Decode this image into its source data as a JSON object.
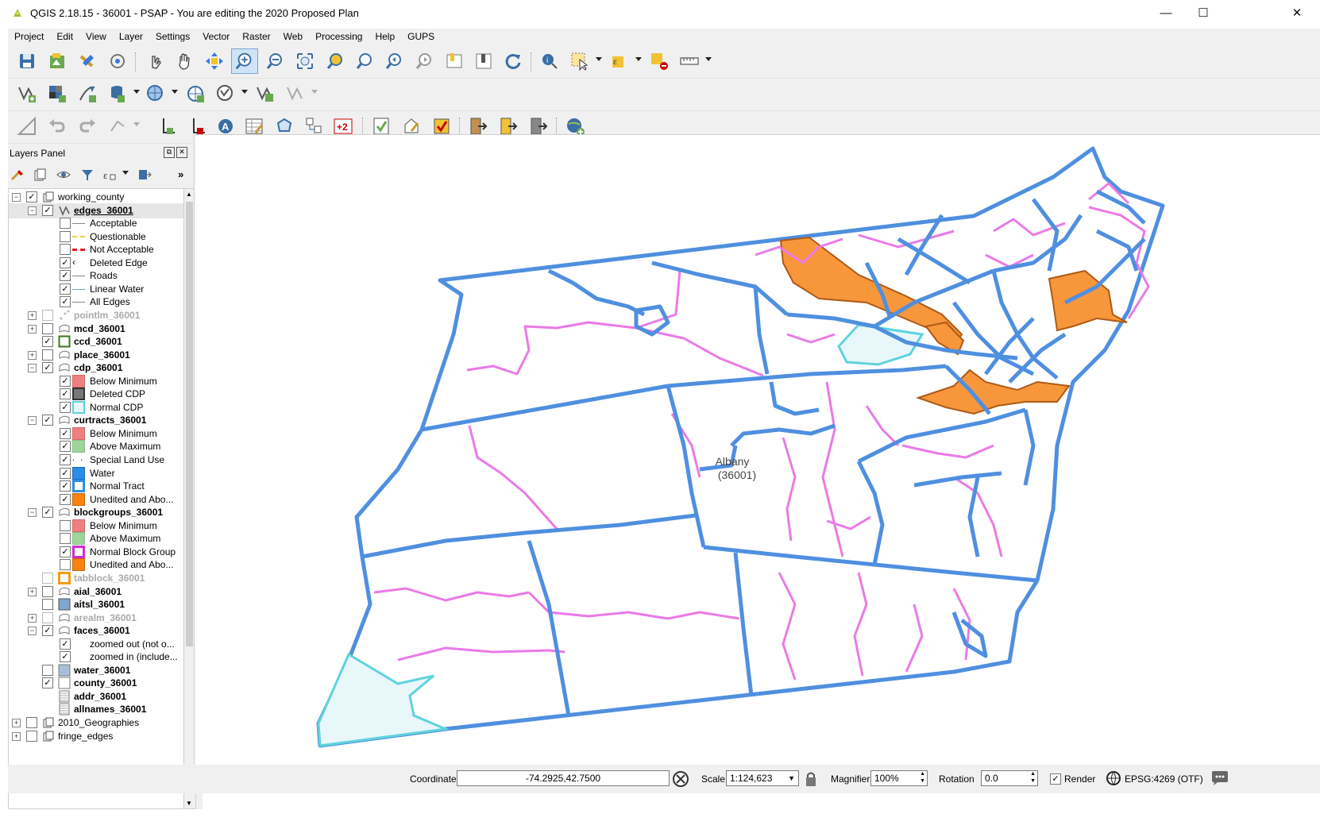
{
  "window": {
    "title": "QGIS 2.18.15 - 36001 - PSAP - You are editing the 2020 Proposed Plan",
    "minimize": "—",
    "maximize": "☐",
    "close": "✕"
  },
  "menu": [
    "Project",
    "Edit",
    "View",
    "Layer",
    "Settings",
    "Vector",
    "Raster",
    "Web",
    "Processing",
    "Help",
    "GUPS"
  ],
  "layers_panel": {
    "title": "Layers Panel",
    "more": "»",
    "tree": [
      {
        "label": "working_county",
        "depth": 0,
        "type": "group",
        "checked": true,
        "expand": "minus",
        "bold": false
      },
      {
        "label": "edges_36001",
        "depth": 1,
        "type": "line-layer",
        "checked": true,
        "expand": "minus",
        "bold": true,
        "selected": true
      },
      {
        "label": "Acceptable",
        "depth": 2,
        "type": "legend",
        "checked": false,
        "symbol": "line-gray"
      },
      {
        "label": "Questionable",
        "depth": 2,
        "type": "legend",
        "checked": false,
        "symbol": "line-yellow-dash"
      },
      {
        "label": "Not Acceptable",
        "depth": 2,
        "type": "legend",
        "checked": false,
        "symbol": "line-red-dash"
      },
      {
        "label": "Deleted Edge",
        "depth": 2,
        "type": "legend",
        "checked": true,
        "symbol": "chevron"
      },
      {
        "label": "Roads",
        "depth": 2,
        "type": "legend",
        "checked": true,
        "symbol": "line-gray"
      },
      {
        "label": "Linear Water",
        "depth": 2,
        "type": "legend",
        "checked": true,
        "symbol": "line-lightblue"
      },
      {
        "label": "All Edges",
        "depth": 2,
        "type": "legend",
        "checked": true,
        "symbol": "line-gray"
      },
      {
        "label": "pointlm_36001",
        "depth": 1,
        "type": "point-layer",
        "checked": false,
        "expand": "plus",
        "bold": true,
        "dim": true
      },
      {
        "label": "mcd_36001",
        "depth": 1,
        "type": "polygon-layer",
        "checked": false,
        "expand": "plus",
        "bold": true
      },
      {
        "label": "ccd_36001",
        "depth": 1,
        "type": "box-green",
        "checked": true,
        "bold": true
      },
      {
        "label": "place_36001",
        "depth": 1,
        "type": "polygon-layer",
        "checked": false,
        "expand": "plus",
        "bold": true
      },
      {
        "label": "cdp_36001",
        "depth": 1,
        "type": "polygon-layer",
        "checked": true,
        "expand": "minus",
        "bold": true
      },
      {
        "label": "Below Minimum",
        "depth": 2,
        "type": "legend",
        "checked": true,
        "symbol": "fill-salmon"
      },
      {
        "label": "Deleted CDP",
        "depth": 2,
        "type": "legend",
        "checked": true,
        "symbol": "fill-darkgray"
      },
      {
        "label": "Normal CDP",
        "depth": 2,
        "type": "legend",
        "checked": true,
        "symbol": "fill-cyan-outline"
      },
      {
        "label": "curtracts_36001",
        "depth": 1,
        "type": "polygon-layer",
        "checked": true,
        "expand": "minus",
        "bold": true
      },
      {
        "label": "Below Minimum",
        "depth": 2,
        "type": "legend",
        "checked": true,
        "symbol": "fill-salmon"
      },
      {
        "label": "Above Maximum",
        "depth": 2,
        "type": "legend",
        "checked": true,
        "symbol": "fill-lightgreen"
      },
      {
        "label": "Special Land Use",
        "depth": 2,
        "type": "legend",
        "checked": true,
        "symbol": "dots"
      },
      {
        "label": "Water",
        "depth": 2,
        "type": "legend",
        "checked": true,
        "symbol": "fill-blue"
      },
      {
        "label": "Normal Tract",
        "depth": 2,
        "type": "legend",
        "checked": true,
        "symbol": "fill-blue-outline"
      },
      {
        "label": "Unedited and Abo...",
        "depth": 2,
        "type": "legend",
        "checked": true,
        "symbol": "fill-orange"
      },
      {
        "label": "blockgroups_36001",
        "depth": 1,
        "type": "polygon-layer",
        "checked": true,
        "expand": "minus",
        "bold": true
      },
      {
        "label": "Below Minimum",
        "depth": 2,
        "type": "legend",
        "checked": false,
        "symbol": "fill-salmon"
      },
      {
        "label": "Above Maximum",
        "depth": 2,
        "type": "legend",
        "checked": false,
        "symbol": "fill-lightgreen"
      },
      {
        "label": "Normal Block Group",
        "depth": 2,
        "type": "legend",
        "checked": true,
        "symbol": "fill-magenta-outline"
      },
      {
        "label": "Unedited and Abo...",
        "depth": 2,
        "type": "legend",
        "checked": false,
        "symbol": "fill-orange"
      },
      {
        "label": "tabblock_36001",
        "depth": 1,
        "type": "box-orange",
        "checked": false,
        "bold": true,
        "dim": true
      },
      {
        "label": "aial_36001",
        "depth": 1,
        "type": "polygon-layer",
        "checked": false,
        "expand": "plus",
        "bold": true
      },
      {
        "label": "aitsl_36001",
        "depth": 1,
        "type": "box-steelblue",
        "checked": false,
        "bold": true
      },
      {
        "label": "arealm_36001",
        "depth": 1,
        "type": "polygon-layer",
        "checked": false,
        "expand": "plus",
        "bold": true,
        "dim": true
      },
      {
        "label": "faces_36001",
        "depth": 1,
        "type": "polygon-layer",
        "checked": true,
        "expand": "minus",
        "bold": true
      },
      {
        "label": "zoomed out (not o...",
        "depth": 2,
        "type": "legend",
        "checked": true,
        "symbol": "none"
      },
      {
        "label": "zoomed in (include...",
        "depth": 2,
        "type": "legend",
        "checked": true,
        "symbol": "none"
      },
      {
        "label": "water_36001",
        "depth": 1,
        "type": "box-lightsteel",
        "checked": false,
        "bold": true
      },
      {
        "label": "county_36001",
        "depth": 1,
        "type": "box-white",
        "checked": true,
        "bold": true
      },
      {
        "label": "addr_36001",
        "depth": 1,
        "type": "table",
        "bold": true
      },
      {
        "label": "allnames_36001",
        "depth": 1,
        "type": "table",
        "bold": true
      },
      {
        "label": "2010_Geographies",
        "depth": 0,
        "type": "group",
        "checked": false,
        "expand": "plus",
        "bold": false
      },
      {
        "label": "fringe_edges",
        "depth": 0,
        "type": "group",
        "checked": false,
        "expand": "plus",
        "bold": false
      }
    ]
  },
  "map": {
    "label_name": "Albany",
    "label_code": "(36001)"
  },
  "status": {
    "coordinate_label": "Coordinate",
    "coordinate_value": "-74.2925,42.7500",
    "scale_label": "Scale",
    "scale_value": "1:124,623",
    "magnifier_label": "Magnifier",
    "magnifier_value": "100%",
    "rotation_label": "Rotation",
    "rotation_value": "0.0",
    "render_label": "Render",
    "render_checked": true,
    "crs": "EPSG:4269 (OTF)"
  },
  "colors": {
    "county_line": "#4f8fe0",
    "blockgroup_line": "#e97ae6",
    "highlight_fill": "#f7963b",
    "cdp_fill": "#e8f7fa",
    "cdp_line": "#5fd3dd"
  }
}
